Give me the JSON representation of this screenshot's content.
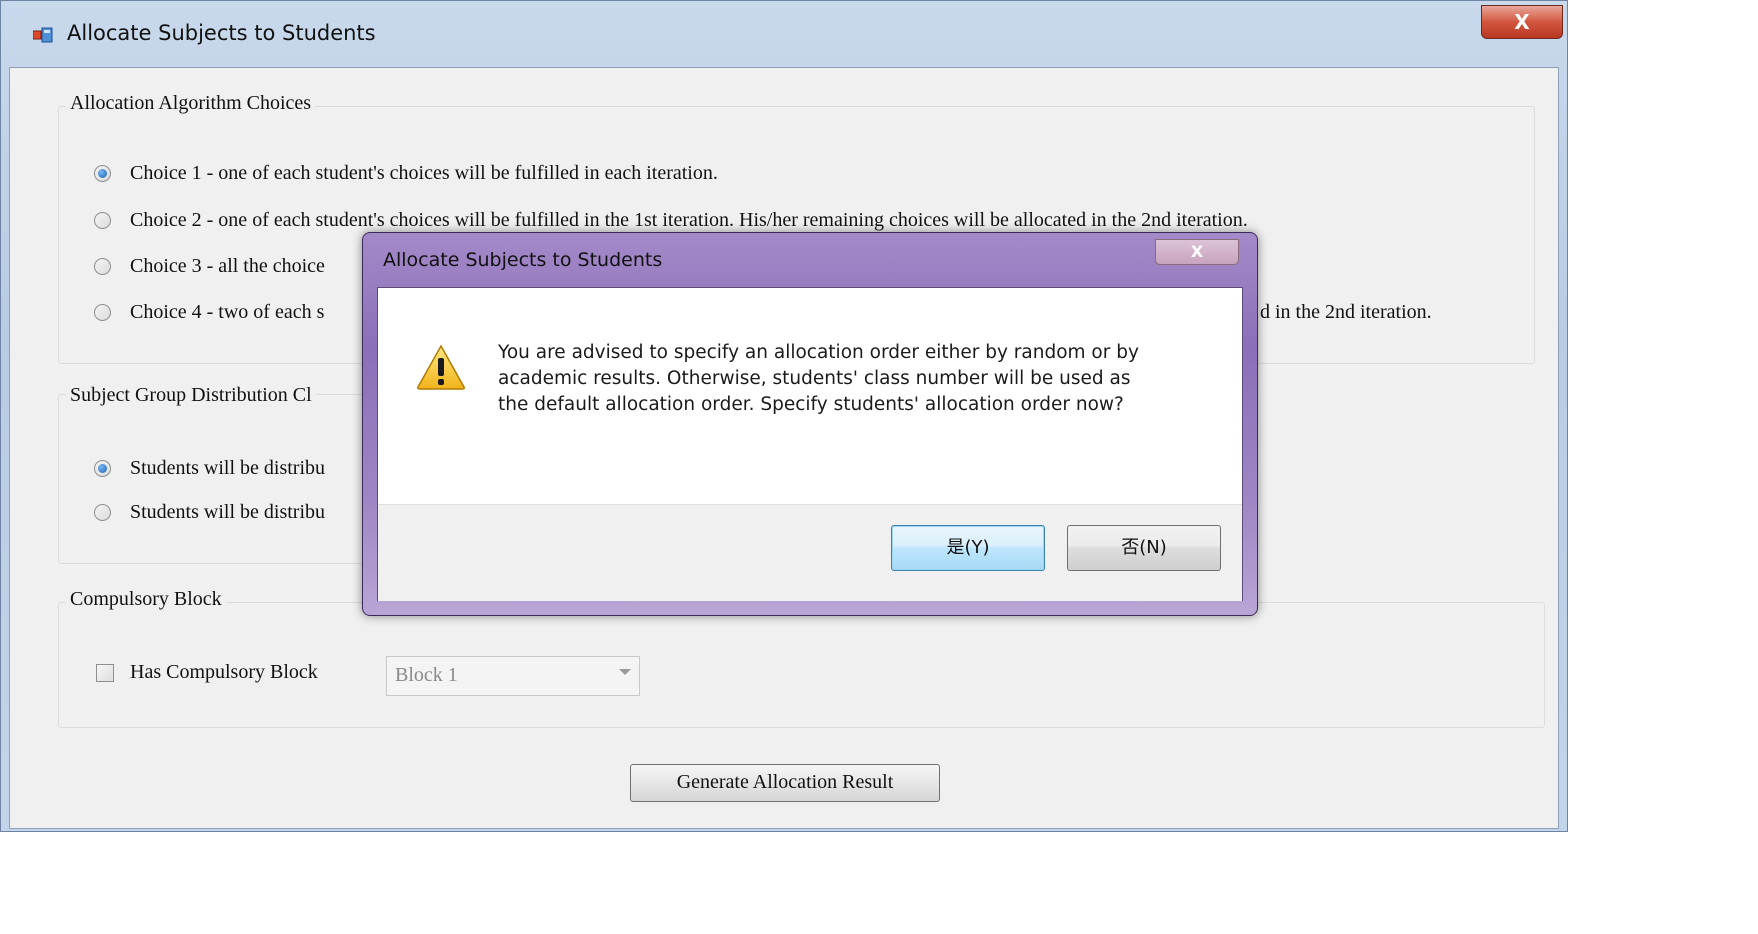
{
  "main_window": {
    "title": "Allocate Subjects to Students",
    "close_label": "X"
  },
  "allocation_group": {
    "legend": "Allocation Algorithm Choices",
    "options": [
      {
        "label": "Choice 1 - one of each student's choices will be fulfilled in each iteration.",
        "checked": true
      },
      {
        "label": "Choice 2 - one of each student's choices will be fulfilled in the 1st iteration. His/her remaining choices will be allocated in the 2nd  iteration.",
        "checked": false
      },
      {
        "label": "Choice 3 - all the choice",
        "checked": false
      },
      {
        "label": "Choice 4 - two of each s",
        "checked": false
      }
    ],
    "choice4_tail": "d in the 2nd  iteration."
  },
  "distribution_group": {
    "legend": "Subject Group Distribution Cl",
    "options": [
      {
        "label": "Students will be distribu",
        "checked": true
      },
      {
        "label": "Students will be distribu",
        "checked": false
      }
    ]
  },
  "compulsory_group": {
    "legend": "Compulsory Block",
    "checkbox_label": "Has Compulsory Block",
    "checked": false,
    "block_select_value": "Block 1"
  },
  "generate_button_label": "Generate Allocation Result",
  "dialog": {
    "title": "Allocate Subjects to Students",
    "close_label": "X",
    "message": "You are advised to specify an allocation order either by random or by academic results. Otherwise, students' class number will be used as the default allocation order. Specify students' allocation order now?",
    "yes_label": "是(Y)",
    "no_label": "否(N)",
    "icon": "warning-icon"
  }
}
